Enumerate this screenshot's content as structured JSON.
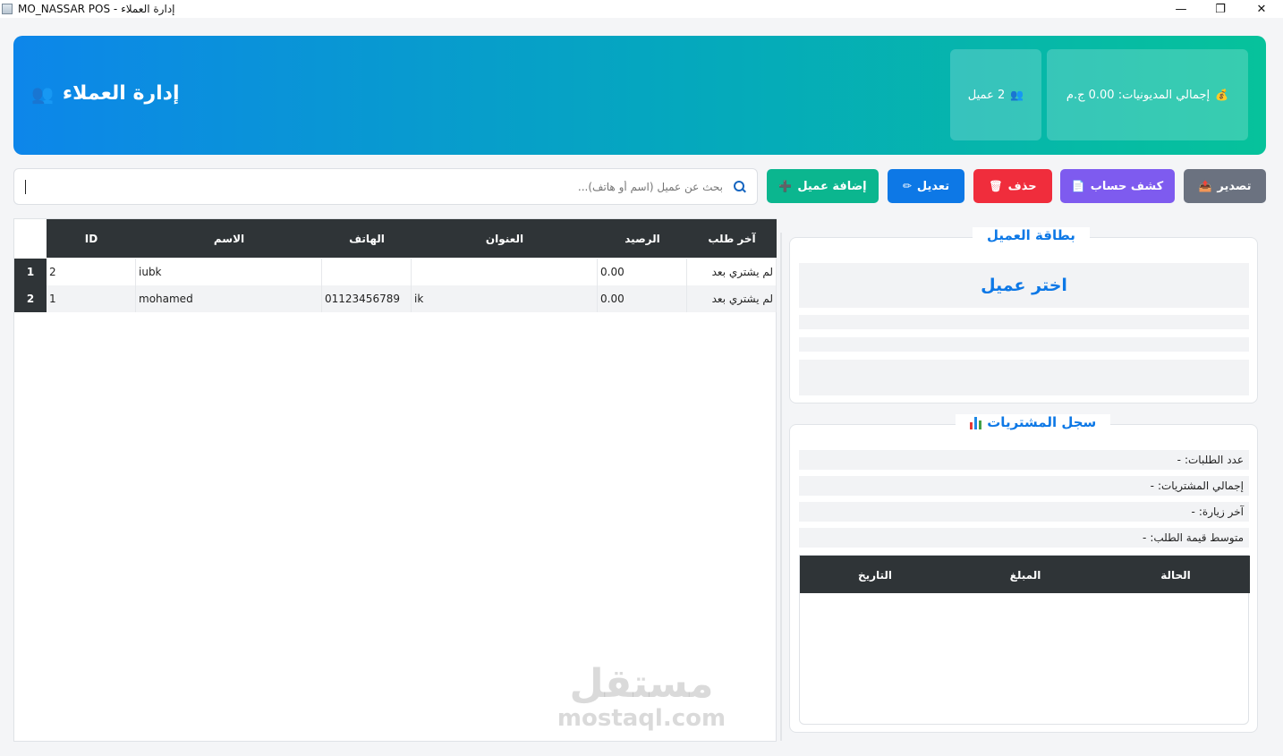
{
  "window": {
    "title": "MO_NASSAR POS - إدارة العملاء",
    "minimize_glyph": "—",
    "maximize_glyph": "❐",
    "close_glyph": "✕"
  },
  "header": {
    "title": "إدارة العملاء",
    "icon": "users-icon",
    "count_label": "2 عميل",
    "debt_label": "إجمالي المديونيات: 0.00 ج.م",
    "debt_icon": "money-bag-icon"
  },
  "search": {
    "placeholder": "بحث عن عميل (اسم أو هاتف)...",
    "value": ""
  },
  "toolbar": {
    "add_label": "إضافة عميل",
    "edit_label": "تعديل",
    "delete_label": "حذف",
    "statement_label": "كشف حساب",
    "export_label": "تصدير"
  },
  "table": {
    "columns": [
      "ID",
      "الاسم",
      "الهاتف",
      "العنوان",
      "الرصيد",
      "آخر طلب"
    ],
    "rows": [
      {
        "num": "1",
        "id": "2",
        "name": "iubk",
        "phone": "",
        "address": "",
        "balance": "0.00",
        "last_order": "لم يشتري بعد"
      },
      {
        "num": "2",
        "id": "1",
        "name": "mohamed",
        "phone": "01123456789",
        "address": "ik",
        "balance": "0.00",
        "last_order": "لم يشتري بعد"
      }
    ]
  },
  "client_card": {
    "legend": "بطاقة العميل",
    "placeholder": "اختر عميل"
  },
  "history": {
    "legend": "سجل المشتريات",
    "stats": [
      {
        "label": "عدد الطلبات:",
        "value": "-"
      },
      {
        "label": "إجمالي المشتريات:",
        "value": "-"
      },
      {
        "label": "آخر زيارة:",
        "value": "-"
      },
      {
        "label": "متوسط قيمة الطلب:",
        "value": "-"
      }
    ],
    "columns": [
      "الحالة",
      "المبلغ",
      "التاريخ"
    ]
  },
  "watermark": {
    "ar": "مستقل",
    "en": "mostaql.com"
  },
  "colors": {
    "header_start": "#0d86ea",
    "header_end": "#06c29b",
    "add": "#0bb68f",
    "edit": "#0d78e6",
    "delete": "#f02d3c",
    "statement": "#7e5bef",
    "export": "#6b7280",
    "table_header": "#2f3437"
  }
}
